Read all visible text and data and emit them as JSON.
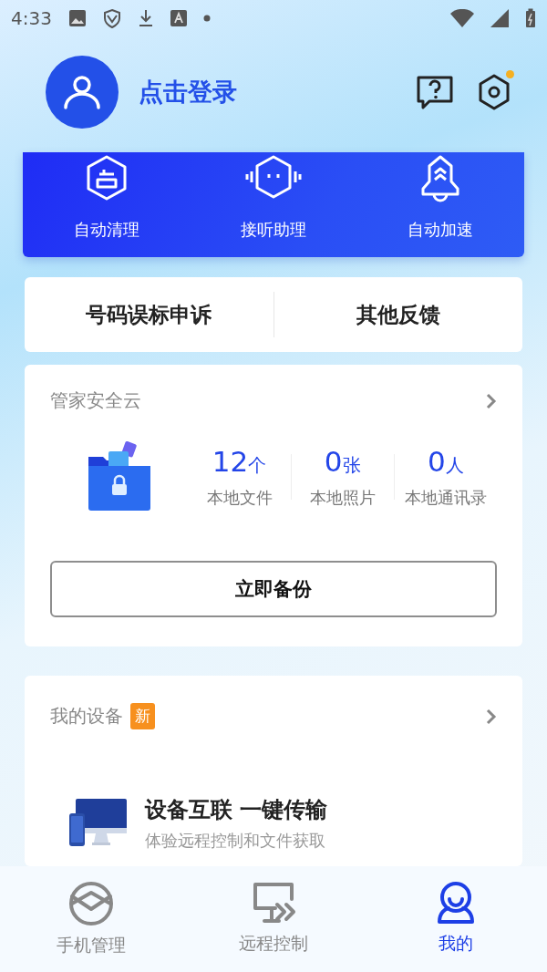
{
  "status_bar": {
    "time": "4:33"
  },
  "header": {
    "login": "点击登录",
    "settings_badge": true
  },
  "quick_actions": [
    {
      "kind": "clean",
      "label": "自动清理"
    },
    {
      "kind": "assistant",
      "label": "接听助理"
    },
    {
      "kind": "boost",
      "label": "自动加速"
    }
  ],
  "feedback": [
    "号码误标申诉",
    "其他反馈"
  ],
  "cloud": {
    "title": "管家安全云",
    "stats": [
      {
        "value": "12",
        "unit": "个",
        "label": "本地文件"
      },
      {
        "value": "0",
        "unit": "张",
        "label": "本地照片"
      },
      {
        "value": "0",
        "unit": "人",
        "label": "本地通讯录"
      }
    ],
    "button": "立即备份"
  },
  "devices": {
    "title": "我的设备",
    "badge": "新",
    "promo_title": "设备互联 一键传输",
    "promo_subtitle": "体验远程控制和文件获取"
  },
  "tabs": [
    {
      "kind": "phone",
      "label": "手机管理",
      "selected": false
    },
    {
      "kind": "remote",
      "label": "远程控制",
      "selected": false
    },
    {
      "kind": "me",
      "label": "我的",
      "selected": true
    }
  ]
}
